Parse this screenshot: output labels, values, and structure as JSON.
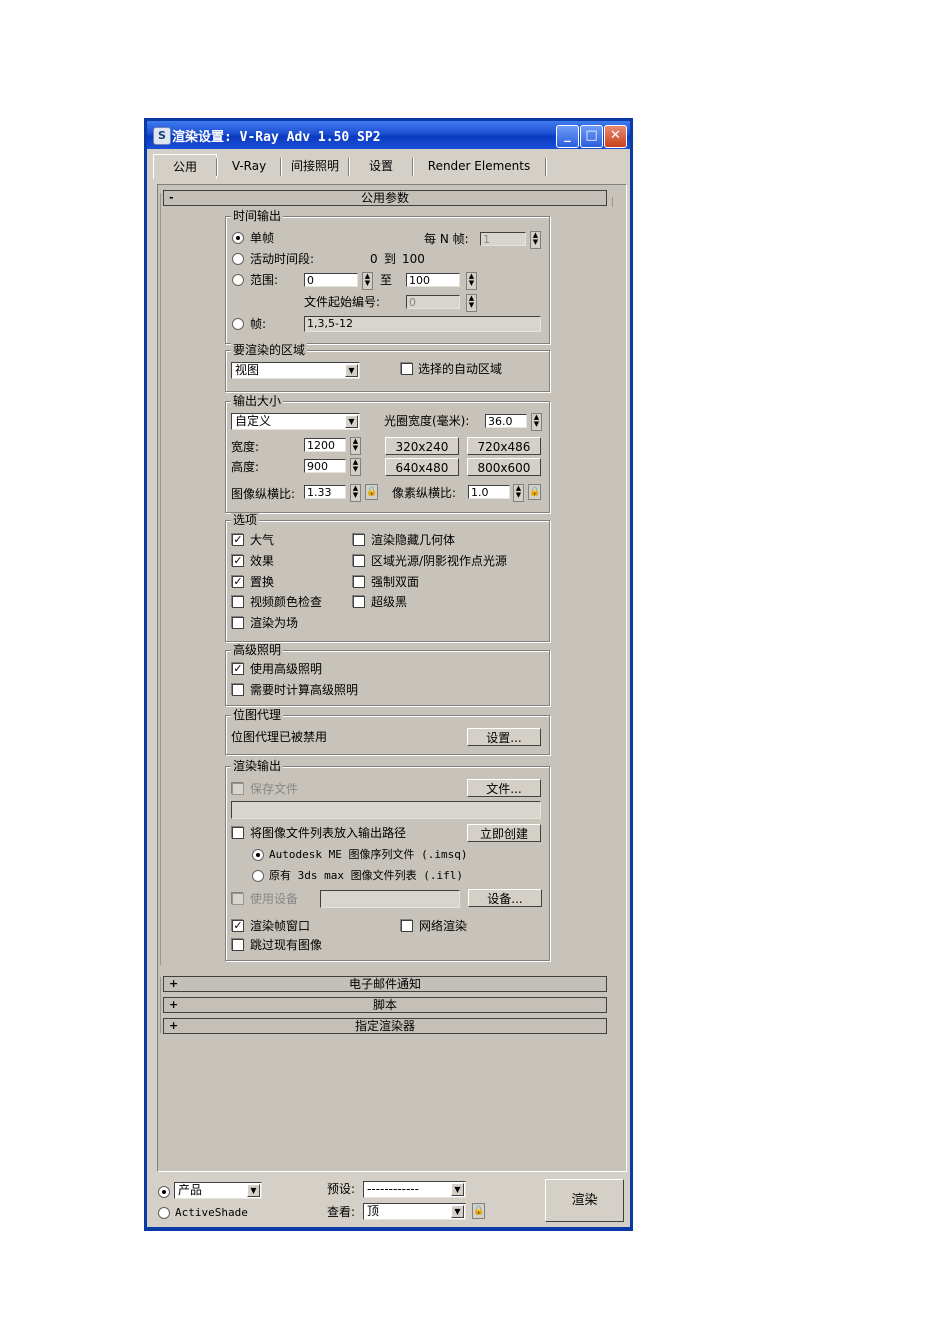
{
  "window": {
    "title": "渲染设置: V-Ray Adv 1.50 SP2",
    "app_icon": "3ds-max-logo-icon",
    "controls": {
      "minimize": "_",
      "maximize": "□",
      "close": "✕"
    }
  },
  "tabs": [
    {
      "label": "公用"
    },
    {
      "label": "V-Ray"
    },
    {
      "label": "间接照明"
    },
    {
      "label": "设置"
    },
    {
      "label": "Render Elements"
    }
  ],
  "rollout_common": {
    "sign": "-",
    "title": "公用参数"
  },
  "time_output": {
    "group": "时间输出",
    "single": "单帧",
    "every_n_label": "每 N 帧:",
    "every_n_value": "1",
    "active_segment": "活动时间段:",
    "segment_from": "0",
    "segment_to_word": "到",
    "segment_to": "100",
    "range": "范围:",
    "range_from": "0",
    "range_to_word": "至",
    "range_to": "100",
    "file_start_label": "文件起始编号:",
    "file_start_value": "0",
    "frames": "帧:",
    "frames_value": "1,3,5-12"
  },
  "area": {
    "group": "要渲染的区域",
    "combo": "视图",
    "auto_region": "选择的自动区域"
  },
  "output_size": {
    "group": "输出大小",
    "combo": "自定义",
    "aperture_label": "光圈宽度(毫米):",
    "aperture_value": "36.0",
    "width_label": "宽度:",
    "width_value": "1200",
    "height_label": "高度:",
    "height_value": "900",
    "presets": [
      "320x240",
      "720x486",
      "640x480",
      "800x600"
    ],
    "image_aspect_label": "图像纵横比:",
    "image_aspect_value": "1.33",
    "pixel_aspect_label": "像素纵横比:",
    "pixel_aspect_value": "1.0"
  },
  "options": {
    "group": "选项",
    "left": [
      {
        "label": "大气",
        "checked": true
      },
      {
        "label": "效果",
        "checked": true
      },
      {
        "label": "置换",
        "checked": true
      },
      {
        "label": "视频颜色检查",
        "checked": false
      },
      {
        "label": "渲染为场",
        "checked": false
      }
    ],
    "right": [
      {
        "label": "渲染隐藏几何体",
        "checked": false
      },
      {
        "label": "区域光源/阴影视作点光源",
        "checked": false
      },
      {
        "label": "强制双面",
        "checked": false
      },
      {
        "label": "超级黑",
        "checked": false
      }
    ]
  },
  "advanced_lighting": {
    "group": "高级照明",
    "use": "使用高级照明",
    "compute": "需要时计算高级照明"
  },
  "bitmap_proxy": {
    "group": "位图代理",
    "status": "位图代理已被禁用",
    "setup_button": "设置..."
  },
  "render_output": {
    "group": "渲染输出",
    "save_file": "保存文件",
    "files_button": "文件...",
    "put_list": "将图像文件列表放入输出路径",
    "create_now": "立即创建",
    "autodesk_option": "Autodesk ME 图像序列文件 (.imsq)",
    "legacy_option": "原有 3ds max 图像文件列表 (.ifl)",
    "use_device": "使用设备",
    "devices_button": "设备...",
    "frame_window": "渲染帧窗口",
    "net_render": "网络渲染",
    "skip_existing": "跳过现有图像"
  },
  "collapsed_rollouts": [
    {
      "sign": "+",
      "title": "电子邮件通知"
    },
    {
      "sign": "+",
      "title": "脚本"
    },
    {
      "sign": "+",
      "title": "指定渲染器"
    }
  ],
  "bottom": {
    "product_combo": "产品",
    "activeshade": "ActiveShade",
    "preset_label": "预设:",
    "preset_value": "------------",
    "view_label": "查看:",
    "view_value": "顶",
    "render_button": "渲染"
  },
  "colors": {
    "titlebar": "#1d4fd3",
    "frame": "#0a3aa6",
    "panel": "#c7c3bb",
    "close_button": "#c9411e"
  }
}
